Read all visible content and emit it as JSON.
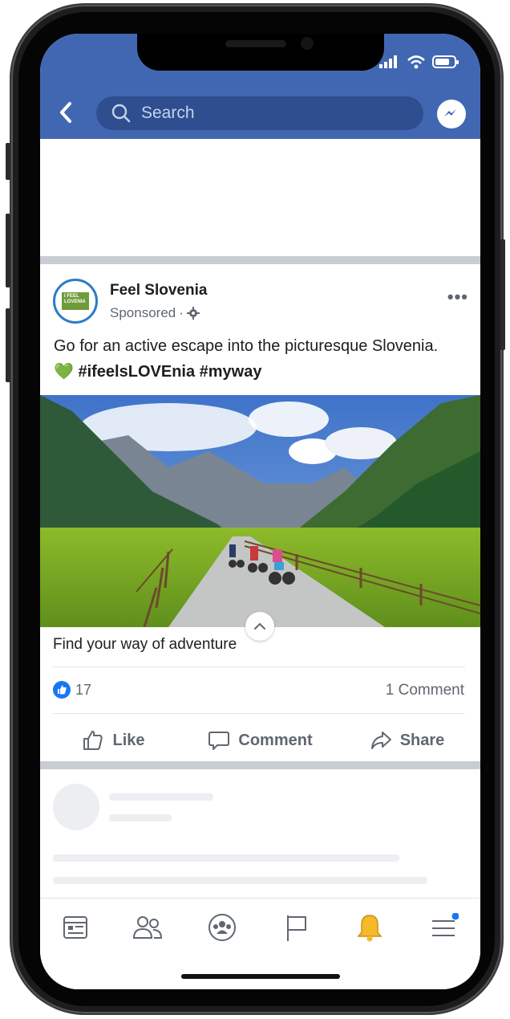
{
  "search": {
    "placeholder": "Search"
  },
  "post": {
    "page_name": "Feel Slovenia",
    "sponsored_label": "Sponsored",
    "meta_separator": " · ",
    "logo_text": "I FEEL LOVENIA",
    "text": "Go for an active escape into the picturesque Slovenia.",
    "heart_emoji": "💚",
    "hashtags": "#ifeelsLOVEnia #myway",
    "link_headline": "Find your way of adventure",
    "like_count": "17",
    "comment_count": "1 Comment"
  },
  "actions": {
    "like": "Like",
    "comment": "Comment",
    "share": "Share"
  },
  "icons": {
    "back": "chevron-left-icon",
    "search": "search-icon",
    "messenger": "messenger-icon",
    "gear": "gear-icon",
    "more": "more-icon",
    "notification_badge_color": "#1877f2"
  },
  "colors": {
    "brand": "#4267b2",
    "search_bg": "#2f4e8f",
    "like_blue": "#1877f2",
    "bell": "#f7b928"
  }
}
